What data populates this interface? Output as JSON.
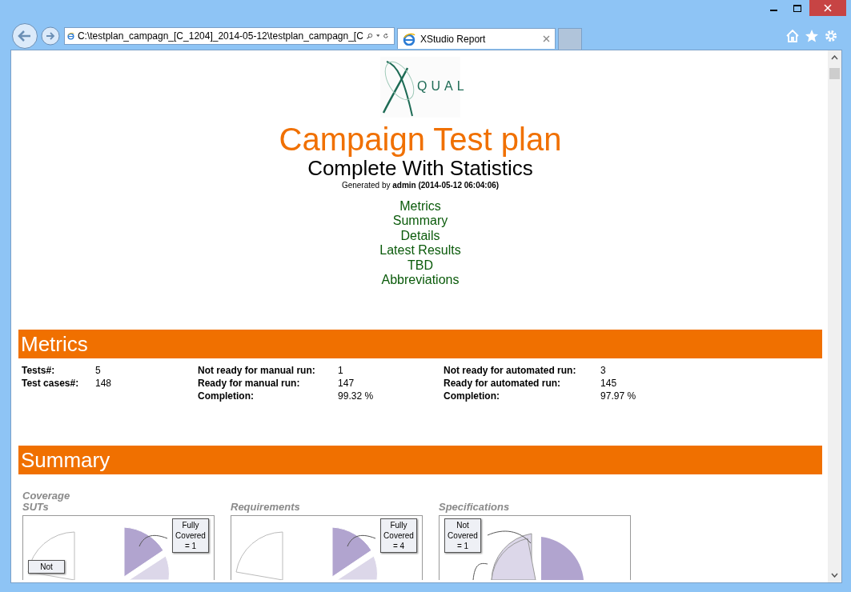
{
  "browser": {
    "address": "C:\\testplan_campagn_[C_1204]_2014-05-12\\testplan_campagn_[C",
    "tabs": [
      {
        "label": "XStudio Report",
        "selected": true
      }
    ]
  },
  "report": {
    "logo_text": "QUAL",
    "title": "Campaign Test plan",
    "subtitle": "Complete With Statistics",
    "generated": "Generated by **admin (2014-05-12 06:04:06)**",
    "nav": [
      "Metrics",
      "Summary",
      "Details",
      "Latest Results",
      "TBD",
      "Abbreviations"
    ],
    "metrics": {
      "heading": "Metrics",
      "groups": [
        [
          {
            "label": "Tests#:",
            "value": "5"
          },
          {
            "label": "Test cases#:",
            "value": "148"
          }
        ],
        [
          {
            "label": "Not ready for manual run:",
            "value": "1"
          },
          {
            "label": "Ready for manual run:",
            "value": "147"
          },
          {
            "label": "Completion:",
            "value": "99.32 %"
          }
        ],
        [
          {
            "label": "Not ready for automated run:",
            "value": "3"
          },
          {
            "label": "Ready for automated run:",
            "value": "145"
          },
          {
            "label": "Completion:",
            "value": "97.97 %"
          }
        ]
      ]
    },
    "summary": {
      "heading": "Summary",
      "charts": [
        {
          "title": "Coverage SUTs",
          "callouts": [
            {
              "text": "Fully Covered = 1"
            },
            {
              "text": "Not"
            }
          ]
        },
        {
          "title": "Requirements",
          "callouts": [
            {
              "text": "Fully Covered = 4"
            }
          ]
        },
        {
          "title": "Specifications",
          "callouts": [
            {
              "text": "Not Covered = 1"
            }
          ]
        }
      ]
    }
  }
}
